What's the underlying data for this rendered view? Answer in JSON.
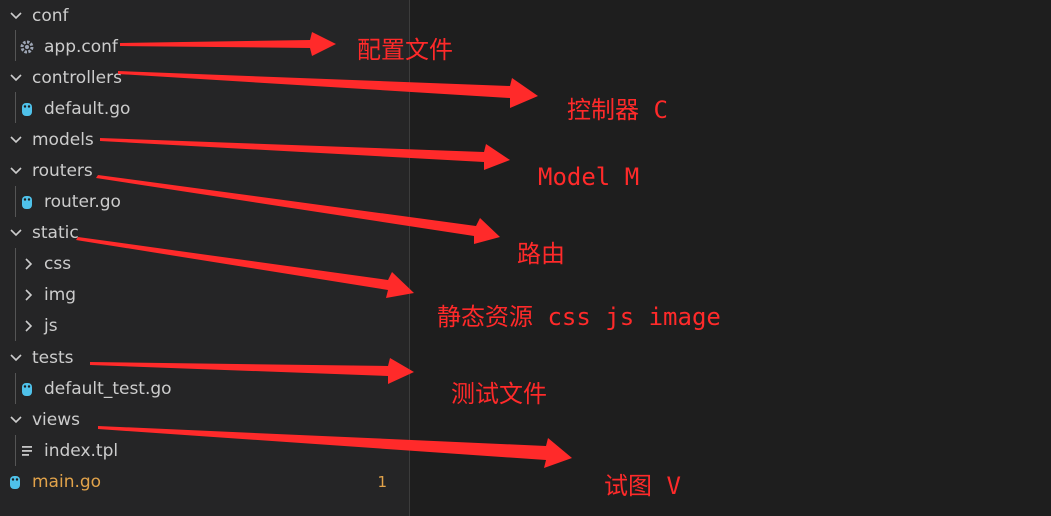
{
  "explorer": {
    "folders": {
      "conf": "conf",
      "controllers": "controllers",
      "models": "models",
      "routers": "routers",
      "static": "static",
      "css": "css",
      "img": "img",
      "js": "js",
      "tests": "tests",
      "views": "views"
    },
    "files": {
      "app_conf": "app.conf",
      "default_go": "default.go",
      "router_go": "router.go",
      "default_test_go": "default_test.go",
      "index_tpl": "index.tpl",
      "main_go": "main.go"
    },
    "main_badge": "1"
  },
  "annotations": {
    "conf": "配置文件",
    "controllers": "控制器 C",
    "models": "Model M",
    "routers": "路由",
    "static": "静态资源  css js image",
    "tests": "测试文件",
    "views": "试图 V"
  },
  "colors": {
    "arrow": "#ff2a2a",
    "go_icon": "#4fc1e9",
    "modified": "#e2a34a"
  }
}
